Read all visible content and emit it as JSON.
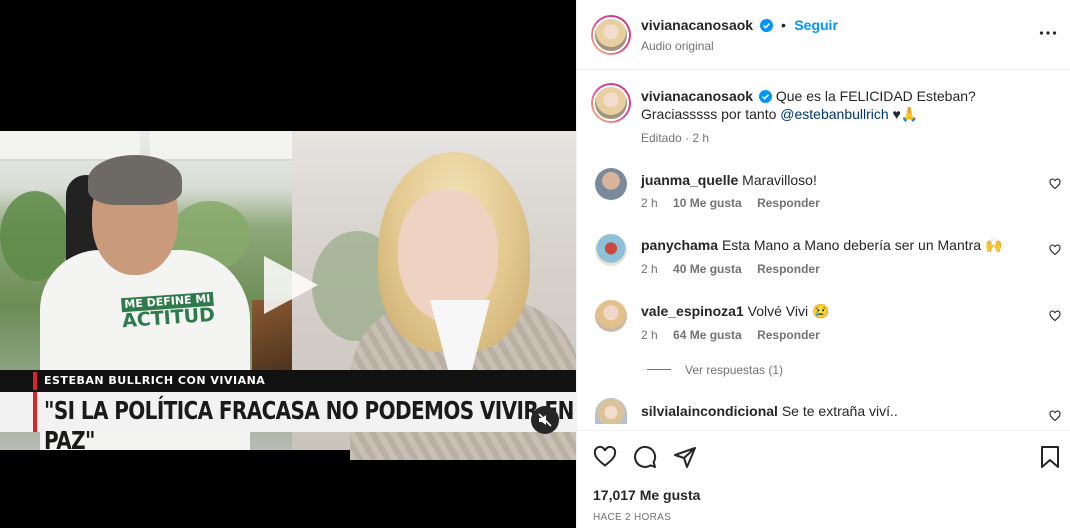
{
  "video": {
    "lower_third_name": "ESTEBAN BULLRICH CON VIVIANA",
    "headline": "\"SI LA POLÍTICA FRACASA NO PODEMOS VIVIR EN PAZ\"",
    "shirt_line1": "ME DEFINE MI",
    "shirt_line2": "ACTITUD"
  },
  "header": {
    "username": "vivianacanosaok",
    "separator": "•",
    "follow_label": "Seguir",
    "audio_label": "Audio original",
    "more_icon": "more-icon"
  },
  "caption": {
    "username": "vivianacanosaok",
    "text_line1": "Que es la FELICIDAD Esteban?",
    "text_line2_prefix": "Graciasssss por tanto ",
    "mention": "@estebanbullrich",
    "text_line2_suffix": " ♥🙏",
    "meta": "Editado · 2 h"
  },
  "comments": [
    {
      "username": "juanma_quelle",
      "text": "Maravilloso!",
      "time": "2 h",
      "likes": "10 Me gusta",
      "reply": "Responder"
    },
    {
      "username": "panychama",
      "text": "Esta Mano a Mano debería ser un Mantra 🙌",
      "time": "2 h",
      "likes": "40 Me gusta",
      "reply": "Responder"
    },
    {
      "username": "vale_espinoza1",
      "text": "Volvé Vivi 😢",
      "time": "2 h",
      "likes": "64 Me gusta",
      "reply": "Responder",
      "view_replies": "Ver respuestas (1)"
    },
    {
      "username": "silvialaincondicional",
      "text": "Se te extraña viví..",
      "time": "",
      "likes": "",
      "reply": ""
    }
  ],
  "footer": {
    "likes": "17,017 Me gusta",
    "time_ago": "HACE 2 HORAS"
  },
  "colors": {
    "accent": "#0095f6",
    "text": "#262626",
    "muted": "#737373",
    "headline_red": "#d3272d"
  }
}
